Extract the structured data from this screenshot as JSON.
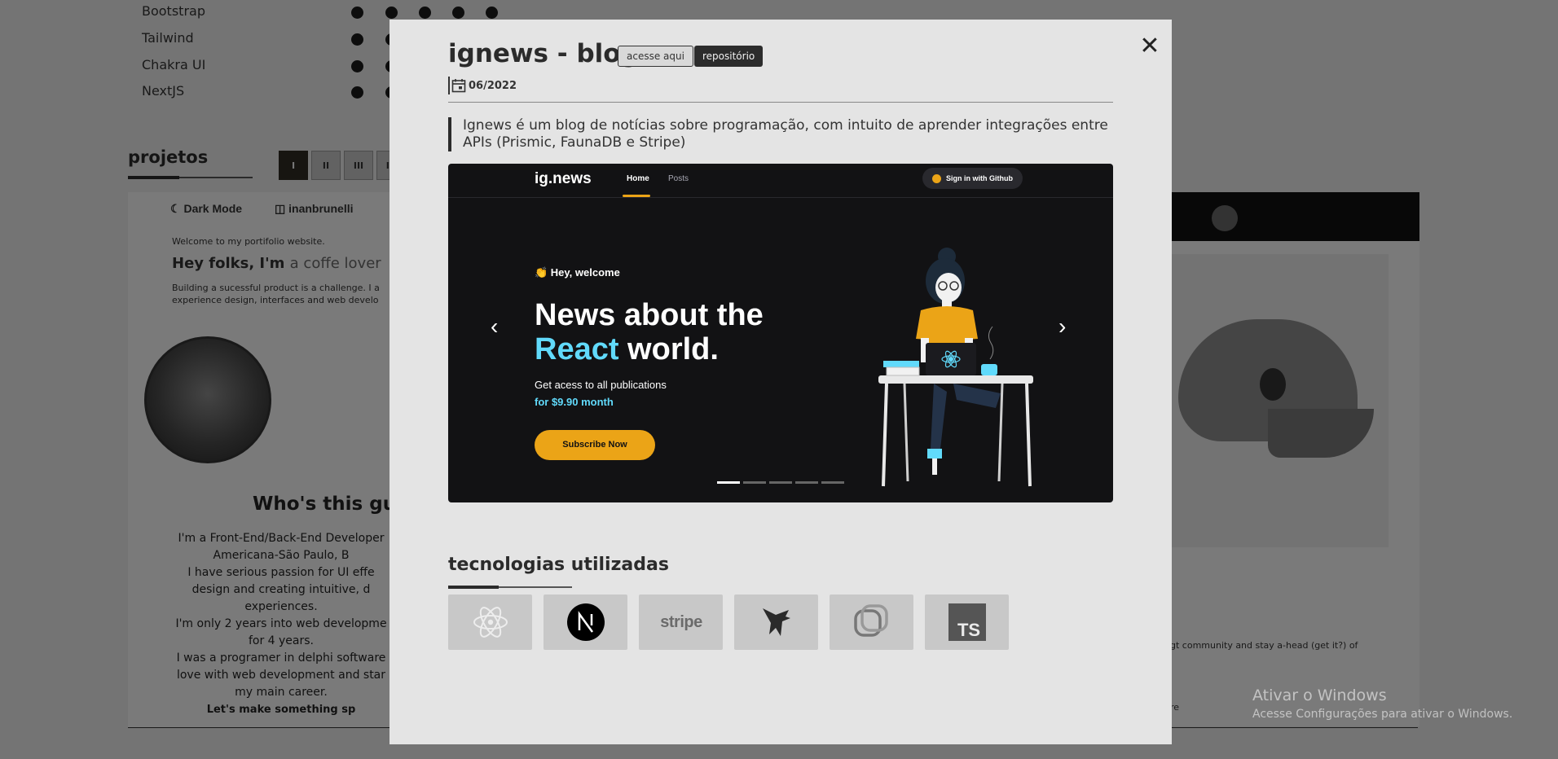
{
  "background": {
    "skills": [
      {
        "name": "Bootstrap",
        "level": 5
      },
      {
        "name": "Tailwind",
        "level": 2
      },
      {
        "name": "Chakra UI",
        "level": 2
      },
      {
        "name": "NextJS",
        "level": 2
      }
    ],
    "projects_heading": "projetos",
    "pager": [
      "I",
      "II",
      "III",
      "IV"
    ],
    "pager_active_index": 0,
    "card_left": {
      "dark_mode": "Dark Mode",
      "username": "inanbrunelli",
      "welcome": "Welcome to my portifolio website.",
      "hey_prefix": "Hey folks, I'm ",
      "hey_accent": "a coffe lover",
      "building": "Building a sucessful product is a challenge. I a experience design, interfaces and web develo",
      "who": "Who's this gu",
      "bio": [
        "I'm a Front-End/Back-End Developer",
        "Americana-São Paulo, B",
        "I have serious passion for UI effe",
        "design and creating intuitive, d",
        "experiences.",
        "I'm only 2 years into web developme",
        "for 4 years.",
        "I was a programer in delphi software",
        "love with web development and star",
        "my main career.",
        "Let's make something sp"
      ]
    },
    "card_right": {
      "community_text": "gt community and stay a-head (get it?) of",
      "more_text": "re"
    }
  },
  "windows_watermark": {
    "line1": "Ativar o Windows",
    "line2": "Acesse Configurações para ativar o Windows."
  },
  "modal": {
    "title": "ignews - blog",
    "link_button": "acesse aqui",
    "repo_button": "repositório",
    "close_symbol": "✕",
    "date": "06/2022",
    "description": "Ignews é um blog de notícias sobre programação, com intuito de aprender integrações entre APIs (Prismic, FaunaDB e Stripe)",
    "preview": {
      "logo_main": "ig.news",
      "nav_home": "Home",
      "nav_posts": "Posts",
      "signin": "Sign in with Github",
      "hey": "👏 Hey, welcome",
      "headline_line1": "News about the",
      "headline_react": "React",
      "headline_rest": " world.",
      "sub": "Get acess to all publications",
      "price": "for $9.90 month",
      "subscribe": "Subscribe Now",
      "arrow_left": "‹",
      "arrow_right": "›",
      "slide_count": 5,
      "active_slide": 0
    },
    "tech_heading": "tecnologias utilizadas",
    "technologies": [
      {
        "name": "React",
        "icon": "react-icon"
      },
      {
        "name": "Next.js",
        "icon": "nextjs-icon"
      },
      {
        "name": "stripe",
        "icon": "stripe-icon"
      },
      {
        "name": "FaunaDB",
        "icon": "faunadb-icon"
      },
      {
        "name": "Prismic",
        "icon": "prismic-icon"
      },
      {
        "name": "TS",
        "icon": "typescript-icon"
      }
    ]
  },
  "colors": {
    "accent_yellow": "#eba417",
    "react_blue": "#61dafb",
    "dark": "#121214"
  }
}
